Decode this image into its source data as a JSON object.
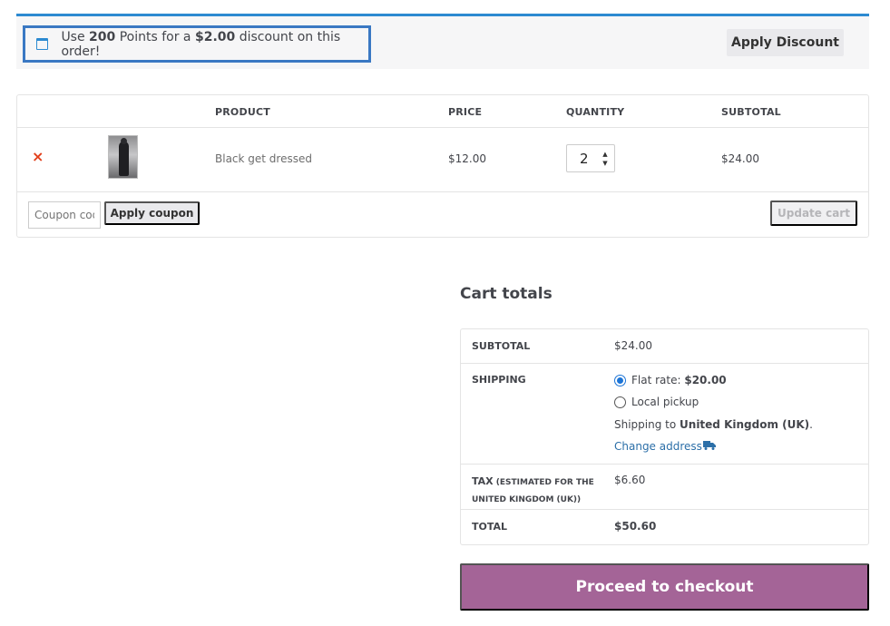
{
  "notice": {
    "text_pre": "Use ",
    "points": "200",
    "text_mid": " Points for a ",
    "amount": "$2.00",
    "text_post": " discount on this order!",
    "button": "Apply Discount"
  },
  "cart": {
    "headers": {
      "product": "PRODUCT",
      "price": "PRICE",
      "quantity": "QUANTITY",
      "subtotal": "SUBTOTAL"
    },
    "items": [
      {
        "remove": "×",
        "name": "Black get dressed",
        "price": "$12.00",
        "quantity": "2",
        "subtotal": "$24.00"
      }
    ],
    "coupon_placeholder": "Coupon code",
    "apply_coupon": "Apply coupon",
    "update_cart": "Update cart"
  },
  "totals": {
    "title": "Cart totals",
    "subtotal_label": "SUBTOTAL",
    "subtotal_value": "$24.00",
    "shipping_label": "SHIPPING",
    "shipping_options": [
      {
        "label": "Flat rate: ",
        "price": "$20.00",
        "selected": true
      },
      {
        "label": "Local pickup",
        "price": "",
        "selected": false
      }
    ],
    "shipping_to_pre": "Shipping to ",
    "shipping_to_country": "United Kingdom (UK)",
    "shipping_to_post": ".",
    "change_address": "Change address",
    "tax_label": "TAX",
    "tax_note_1": " (ESTIMATED FOR THE",
    "tax_note_2": "UNITED KINGDOM (UK))",
    "tax_value": "$6.60",
    "total_label": "TOTAL",
    "total_value": "$50.60",
    "checkout": "Proceed to checkout"
  },
  "colors": {
    "accent_blue": "#2c8ad1",
    "checkout_purple": "#a46497",
    "remove_red": "#e2401c",
    "link_blue": "#2c6fa8"
  },
  "icons": {
    "notice": "calendar-icon",
    "remove": "remove-x-icon",
    "truck": "truck-icon"
  }
}
